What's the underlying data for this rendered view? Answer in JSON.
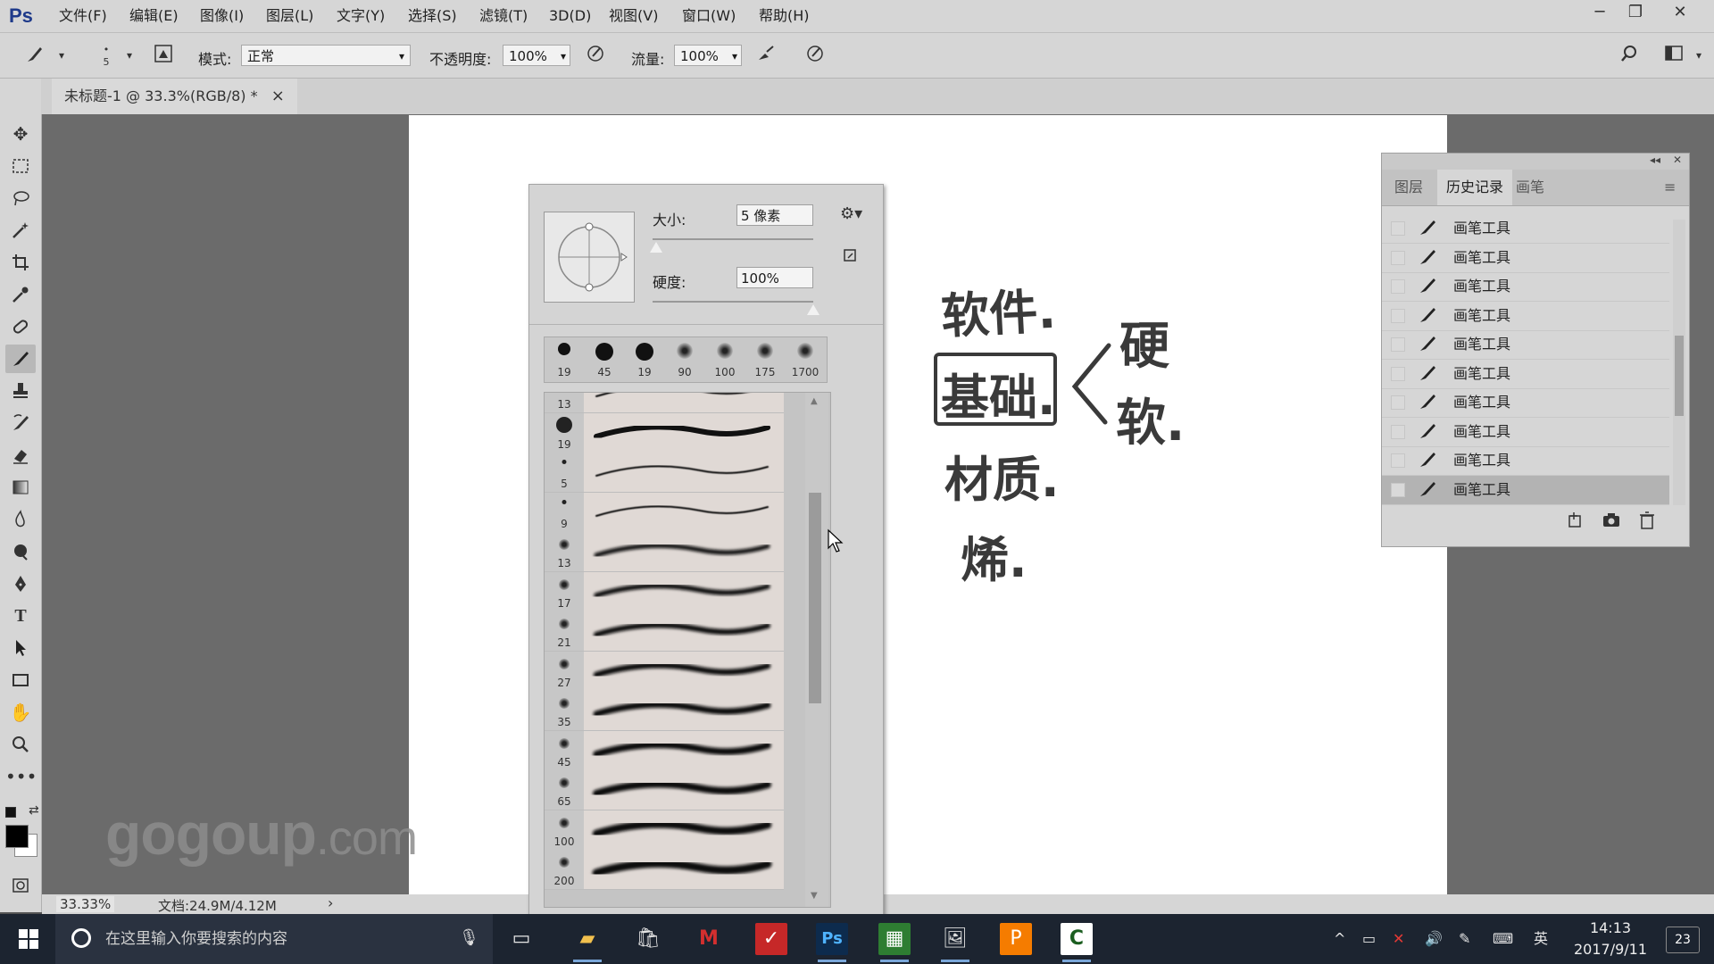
{
  "app": {
    "logo": "Ps"
  },
  "menu": [
    "文件(F)",
    "编辑(E)",
    "图像(I)",
    "图层(L)",
    "文字(Y)",
    "选择(S)",
    "滤镜(T)",
    "3D(D)",
    "视图(V)",
    "窗口(W)",
    "帮助(H)"
  ],
  "window_controls": {
    "minimize": "─",
    "restore": "❐",
    "close": "✕"
  },
  "options": {
    "brush_size_small": "5",
    "mode_label": "模式:",
    "mode_value": "正常",
    "opacity_label": "不透明度:",
    "opacity_value": "100%",
    "flow_label": "流量:",
    "flow_value": "100%"
  },
  "document_tab": {
    "title": "未标题-1 @ 33.3%(RGB/8) *",
    "close": "×"
  },
  "status": {
    "zoom": "33.33%",
    "doc": "文档:24.9M/4.12M"
  },
  "watermark": {
    "main": "gogoup",
    "suffix": ".com"
  },
  "brush_popup": {
    "size_label": "大小:",
    "size_value": "5 像素",
    "hardness_label": "硬度:",
    "hardness_value": "100%",
    "size_fraction": 0.02,
    "hardness_fraction": 1.0,
    "recent_brushes": [
      "19",
      "45",
      "19",
      "90",
      "100",
      "175",
      "1700"
    ],
    "brush_list": [
      "13",
      "19",
      "5",
      "9",
      "13",
      "17",
      "21",
      "27",
      "35",
      "45",
      "65",
      "100",
      "200"
    ]
  },
  "handwriting": {
    "line1": "软件.",
    "boxed": "基础.",
    "branch_hard": "硬",
    "branch_soft": "软.",
    "line3": "材质.",
    "line4": "烯."
  },
  "history_panel": {
    "tabs": [
      "图层",
      "历史记录",
      "画笔"
    ],
    "active_tab": "历史记录",
    "items": [
      "画笔工具",
      "画笔工具",
      "画笔工具",
      "画笔工具",
      "画笔工具",
      "画笔工具",
      "画笔工具",
      "画笔工具",
      "画笔工具",
      "画笔工具"
    ],
    "selected_index": 9
  },
  "taskbar": {
    "search_placeholder": "在这里输入你要搜索的内容",
    "ime": "英",
    "time": "14:13",
    "date": "2017/9/11",
    "notifications": "23"
  },
  "colors": {
    "foreground": "#000000",
    "background": "#ffffff"
  }
}
